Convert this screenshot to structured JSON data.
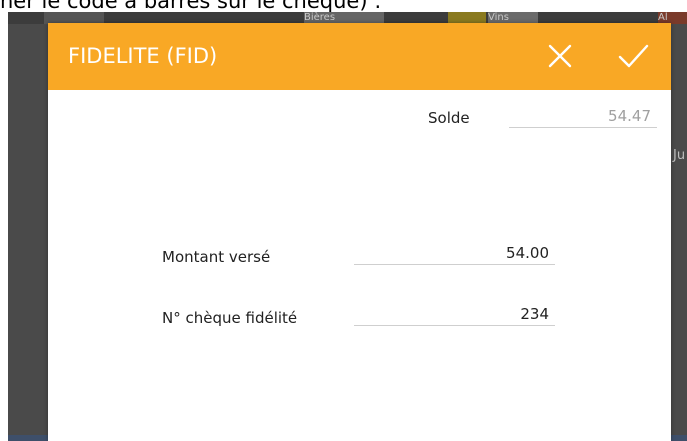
{
  "caption": "ner le code à barres sur le chèque) :",
  "background": {
    "tiles": [
      "Bières",
      "Vins",
      "Al"
    ],
    "side_text": "Ju"
  },
  "dialog": {
    "title": "FIDELITE (FID)",
    "close_icon": "close-icon",
    "confirm_icon": "check-icon",
    "header_color": "#f9a825"
  },
  "fields": {
    "solde": {
      "label": "Solde",
      "value": "54.47"
    },
    "montant_verse": {
      "label": "Montant versé",
      "value": "54.00"
    },
    "cheque_fidelite": {
      "label": "N° chèque fidélité",
      "value": "234"
    }
  }
}
